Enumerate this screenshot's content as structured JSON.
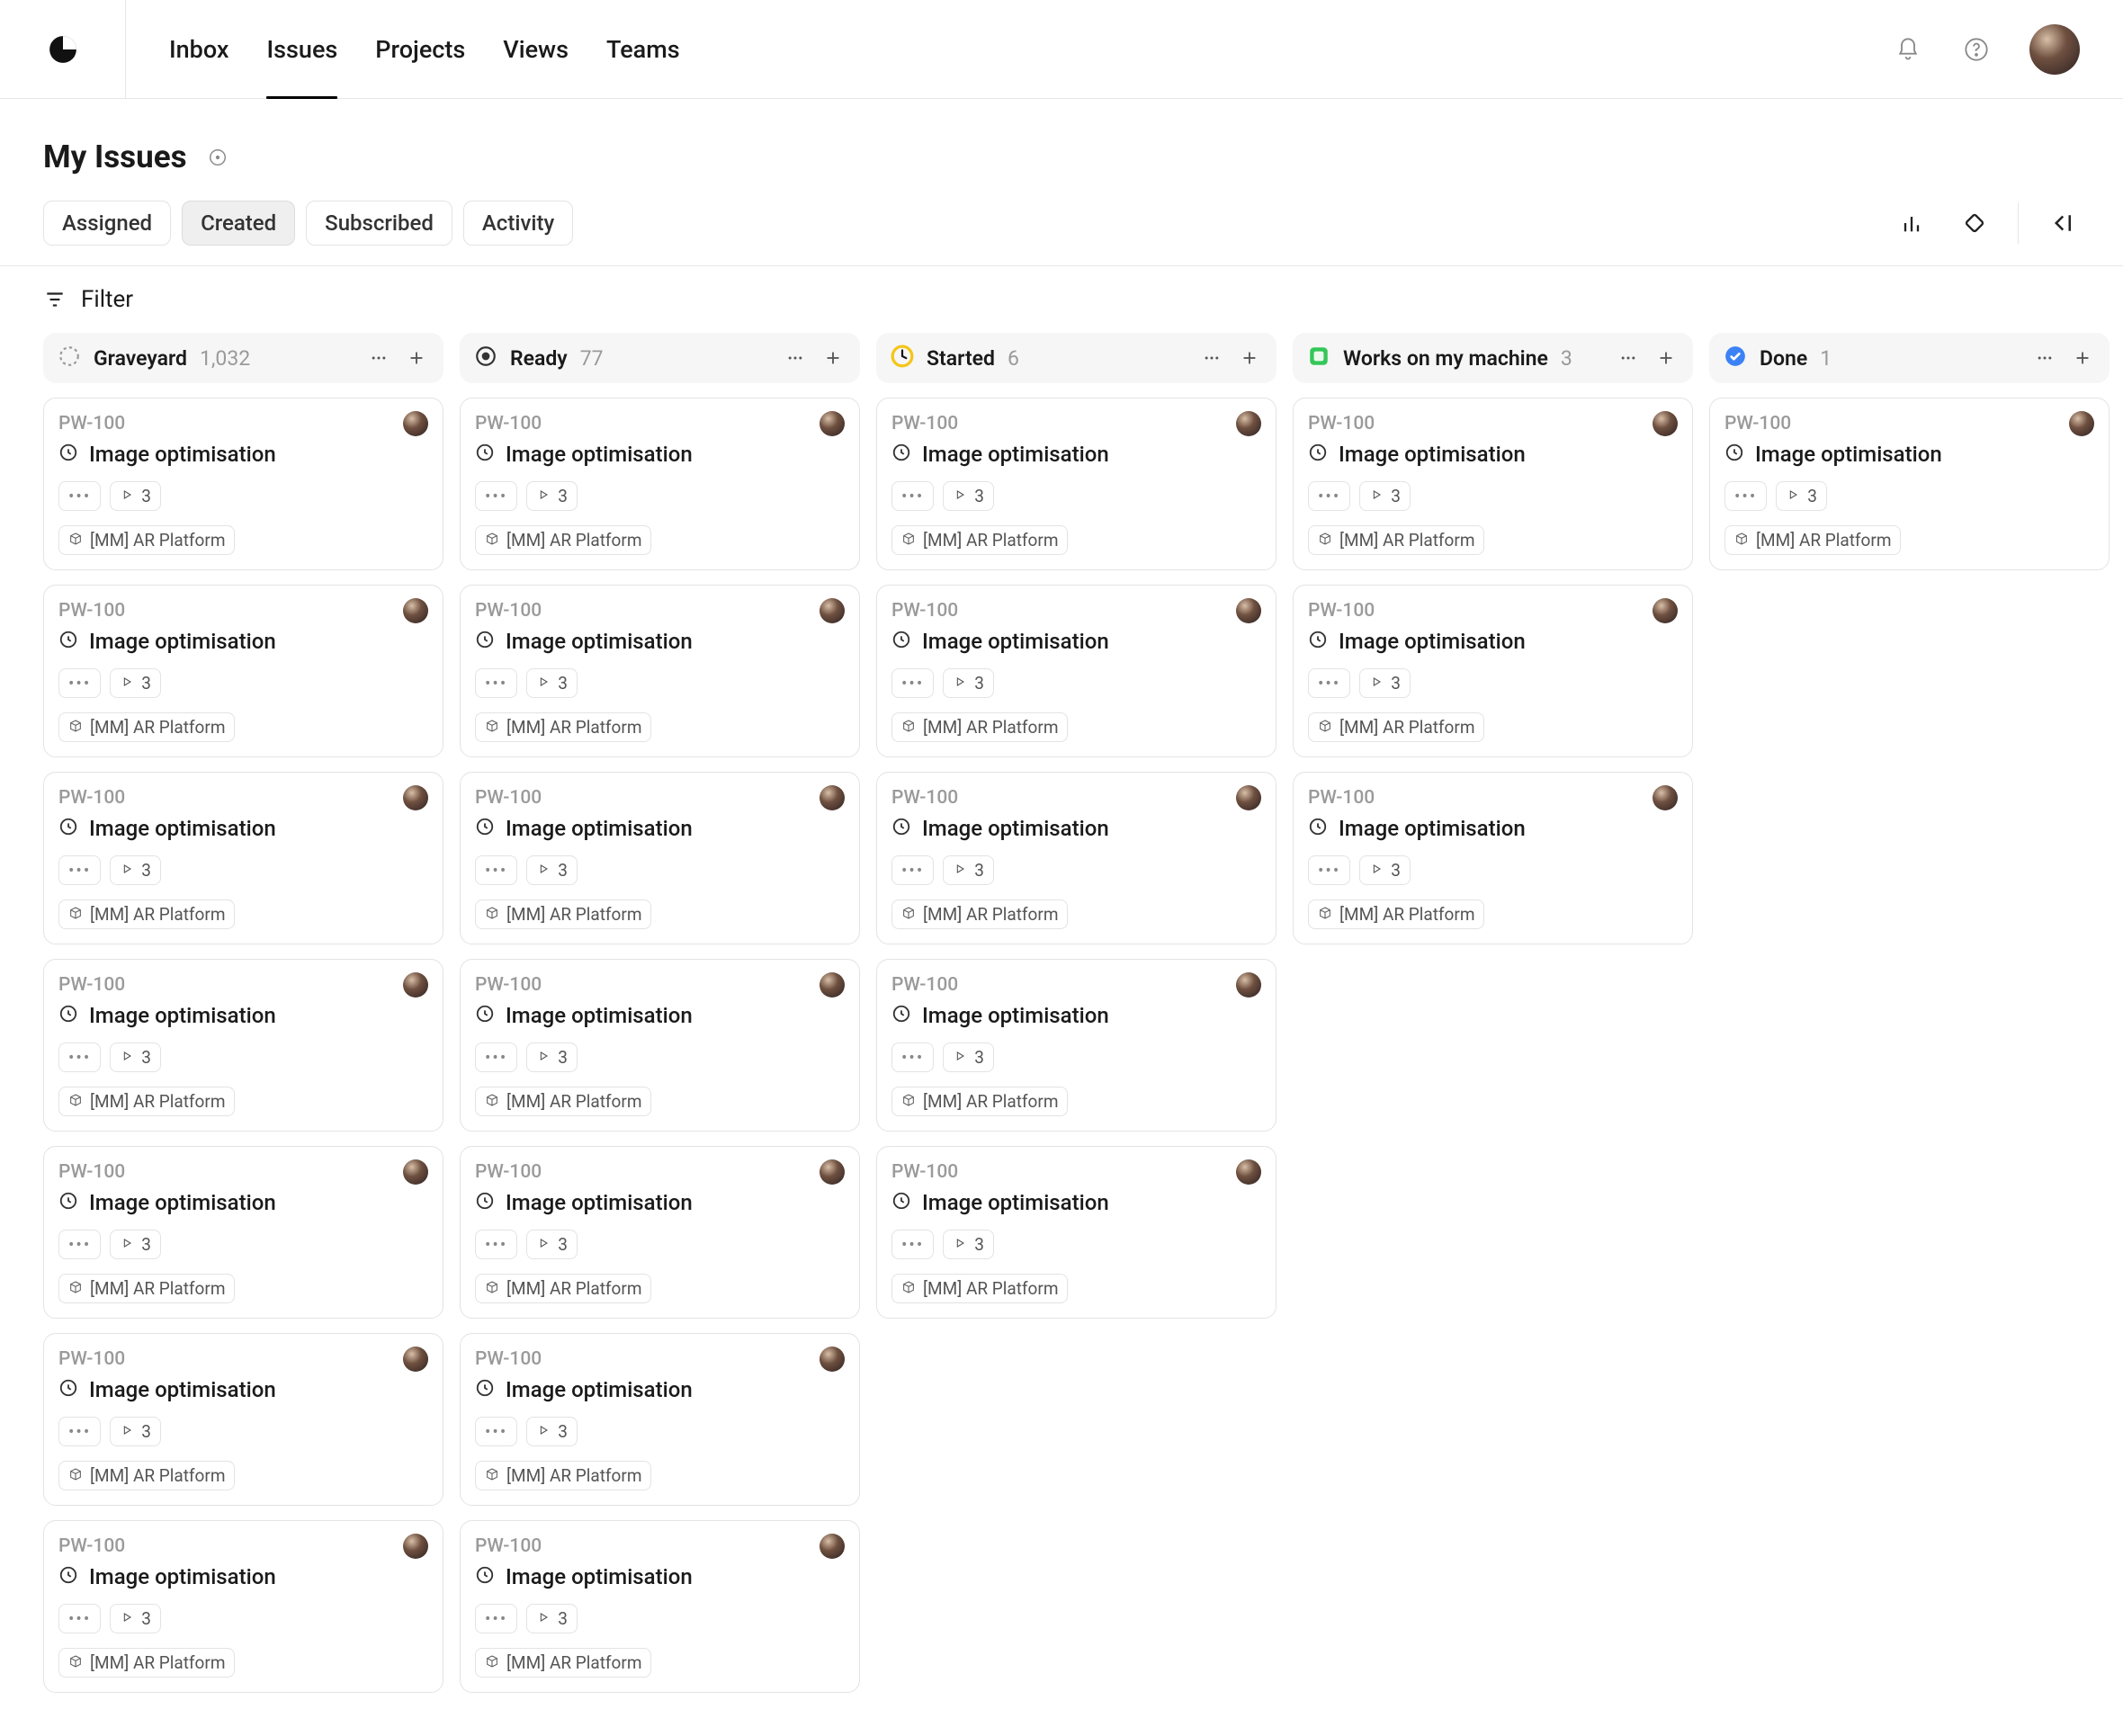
{
  "nav": {
    "items": [
      "Inbox",
      "Issues",
      "Projects",
      "Views",
      "Teams"
    ],
    "active_index": 1
  },
  "page": {
    "title": "My Issues"
  },
  "seg_tabs": {
    "items": [
      "Assigned",
      "Created",
      "Subscribed",
      "Activity"
    ],
    "active_index": 1
  },
  "filter_label": "Filter",
  "card_template": {
    "issue_id": "PW-100",
    "title": "Image optimisation",
    "subtask_count": "3",
    "project_chip": "[MM] AR Platform",
    "more_chip": "•••"
  },
  "columns": [
    {
      "id": "graveyard",
      "title": "Graveyard",
      "count": "1,032",
      "icon": "dashed-circle",
      "card_count": 7
    },
    {
      "id": "ready",
      "title": "Ready",
      "count": "77",
      "icon": "ready",
      "card_count": 7
    },
    {
      "id": "started",
      "title": "Started",
      "count": "6",
      "icon": "started",
      "card_count": 5
    },
    {
      "id": "works",
      "title": "Works on my machine",
      "count": "3",
      "icon": "works",
      "card_count": 3
    },
    {
      "id": "done",
      "title": "Done",
      "count": "1",
      "icon": "done",
      "card_count": 1
    }
  ]
}
